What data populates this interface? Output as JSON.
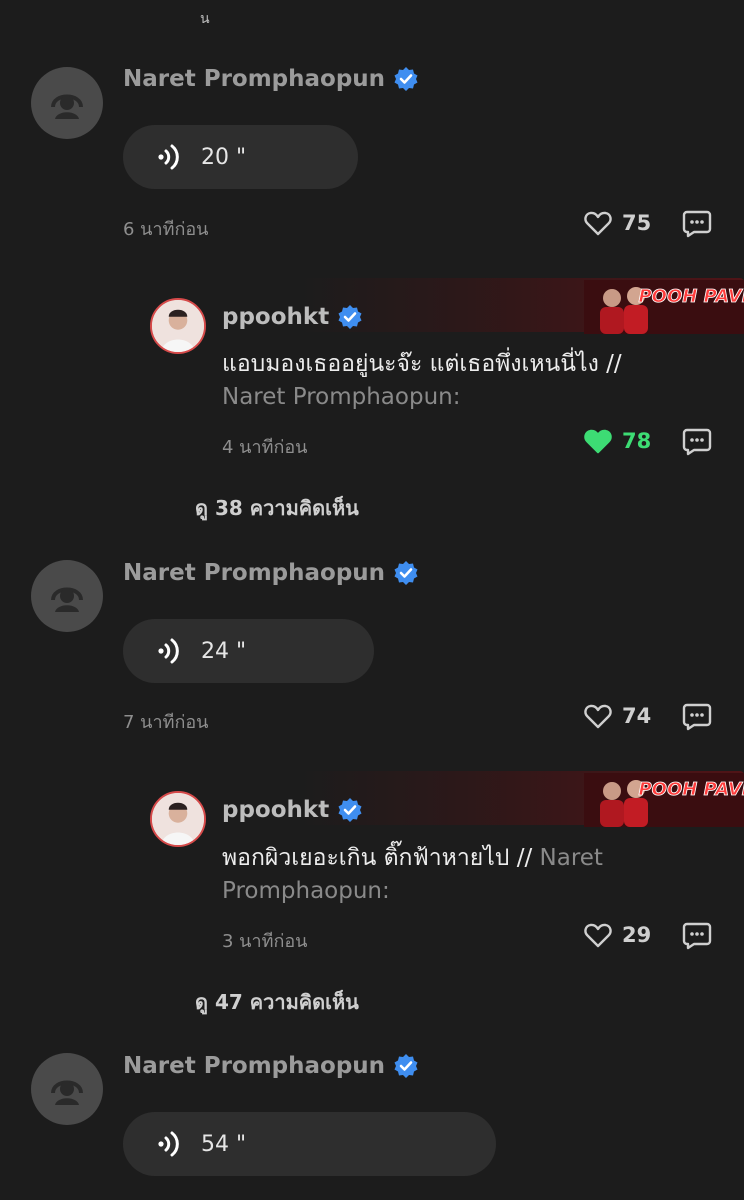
{
  "top_fragment": "น",
  "comments": [
    {
      "author": "Naret Promphaopun",
      "voice_duration": "20 \"",
      "time": "6 นาทีก่อน",
      "likes": "75",
      "liked": false,
      "reply": {
        "author": "ppoohkt",
        "text": "แอบมองเธออยู่นะจ๊ะ แต่เธอพึ่งเหนนี่ไง //",
        "mention": "Naret Promphaopun:",
        "time": "4 นาทีก่อน",
        "likes": "78",
        "liked": true,
        "banner_text": "POOH PAVEL"
      },
      "view_more": "ดู 38 ความคิดเห็น"
    },
    {
      "author": "Naret Promphaopun",
      "voice_duration": "24 \"",
      "time": "7 นาทีก่อน",
      "likes": "74",
      "liked": false,
      "reply": {
        "author": "ppoohkt",
        "text": "พอกผิวเยอะเกิน ติ๊กฟ้าหายไป //",
        "mention": "Naret Promphaopun:",
        "time": "3 นาทีก่อน",
        "likes": "29",
        "liked": false,
        "banner_text": "POOH PAVEL"
      },
      "view_more": "ดู 47 ความคิดเห็น"
    },
    {
      "author": "Naret Promphaopun",
      "voice_duration": "54 \""
    }
  ],
  "colors": {
    "background": "#1c1c1c",
    "verified": "#3f8ef0",
    "liked": "#3ddc74",
    "bubble": "#2e2e2e"
  }
}
